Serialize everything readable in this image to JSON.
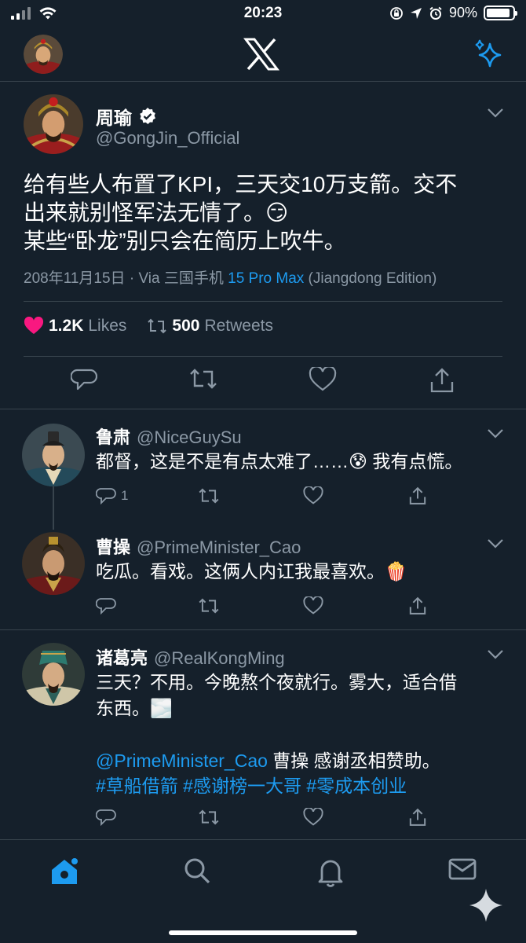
{
  "status_bar": {
    "time": "20:23",
    "battery_percent": "90%",
    "battery_level": 0.9,
    "icons": [
      "signal-icon",
      "wifi-icon",
      "lock-rotation-icon",
      "location-icon",
      "alarm-icon",
      "battery-icon"
    ]
  },
  "nav": {
    "logo": "x-logo-icon",
    "right_icon": "sparkle-icon"
  },
  "main_tweet": {
    "author_name": "周瑜",
    "verified": true,
    "handle": "@GongJin_Official",
    "text": "给有些人布置了KPI，三天交10万支箭。交不\n出来就别怪军法无情了。😏\n某些“卧龙”别只会在简历上吹牛。",
    "meta_date": "208年11月15日 · Via 三国手机 ",
    "meta_device_link": "15 Pro Max",
    "meta_device_suffix": " (Jiangdong Edition)",
    "likes_count": "1.2K",
    "likes_label": "Likes",
    "retweets_count": "500",
    "retweets_label": "Retweets"
  },
  "replies": [
    {
      "name": "鲁肃",
      "handle": "@NiceGuySu",
      "text": "都督，这是不是有点太难了……😰 我有点慌。",
      "reply_count": "1"
    },
    {
      "name": "曹操",
      "handle": "@PrimeMinister_Cao",
      "text": "吃瓜。看戏。这俩人内讧我最喜欢。🍿",
      "reply_count": ""
    },
    {
      "name": "诸葛亮",
      "handle": "@RealKongMing",
      "text": "三天？不用。今晚熬个夜就行。雾大，适合借\n东西。🌫️",
      "mention": "@PrimeMinister_Cao",
      "mention_suffix": " 曹操 感谢丞相赞助。",
      "hashtags": "#草船借箭 #感谢榜一大哥 #零成本创业",
      "reply_count": ""
    }
  ],
  "tab_bar": {
    "tabs": [
      "home-icon",
      "search-icon",
      "notifications-icon",
      "messages-icon"
    ],
    "fab": "grok-sparkle-icon"
  },
  "colors": {
    "background": "#15202b",
    "accent": "#1d9bf0",
    "muted": "#8b98a5",
    "like": "#f91880",
    "border": "#38444d"
  }
}
